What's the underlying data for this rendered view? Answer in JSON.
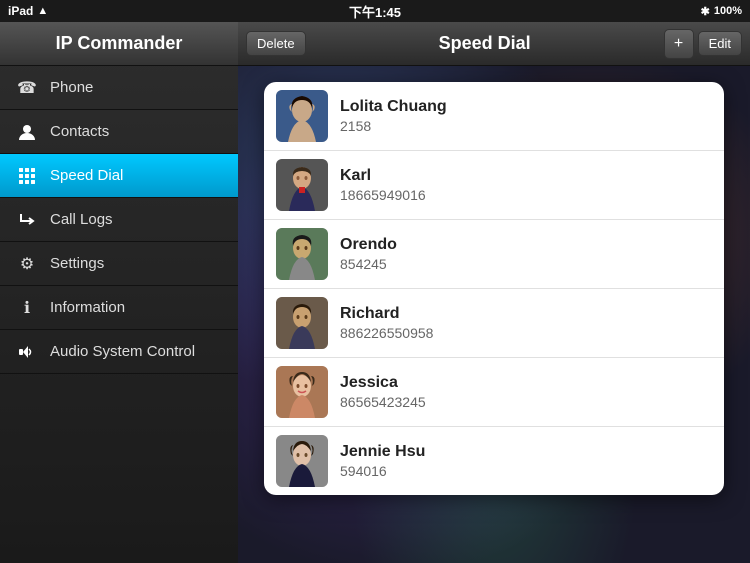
{
  "status_bar": {
    "left": "iPad",
    "wifi_icon": "wifi",
    "time": "下午1:45",
    "bluetooth_icon": "bluetooth",
    "battery": "100%"
  },
  "sidebar": {
    "title": "IP Commander",
    "items": [
      {
        "id": "phone",
        "label": "Phone",
        "icon": "☎",
        "active": false
      },
      {
        "id": "contacts",
        "label": "Contacts",
        "icon": "👤",
        "active": false
      },
      {
        "id": "speed-dial",
        "label": "Speed Dial",
        "icon": "⊞",
        "active": true
      },
      {
        "id": "call-logs",
        "label": "Call Logs",
        "icon": "↺",
        "active": false
      },
      {
        "id": "settings",
        "label": "Settings",
        "icon": "⚙",
        "active": false
      },
      {
        "id": "information",
        "label": "Information",
        "icon": "ℹ",
        "active": false
      },
      {
        "id": "audio-system",
        "label": "Audio System Control",
        "icon": "🔊",
        "active": false
      }
    ]
  },
  "toolbar": {
    "delete_label": "Delete",
    "title": "Speed Dial",
    "add_label": "+",
    "edit_label": "Edit"
  },
  "contacts": [
    {
      "id": "lolita",
      "name": "Lolita Chuang",
      "number": "2158",
      "avatar_class": "avatar-lolita"
    },
    {
      "id": "karl",
      "name": "Karl",
      "number": "18665949016",
      "avatar_class": "avatar-karl"
    },
    {
      "id": "orendo",
      "name": "Orendo",
      "number": "854245",
      "avatar_class": "avatar-orendo"
    },
    {
      "id": "richard",
      "name": "Richard",
      "number": "886226550958",
      "avatar_class": "avatar-richard"
    },
    {
      "id": "jessica",
      "name": "Jessica",
      "number": "86565423245",
      "avatar_class": "avatar-jessica"
    },
    {
      "id": "jennie",
      "name": "Jennie Hsu",
      "number": "594016",
      "avatar_class": "avatar-jennie"
    }
  ]
}
